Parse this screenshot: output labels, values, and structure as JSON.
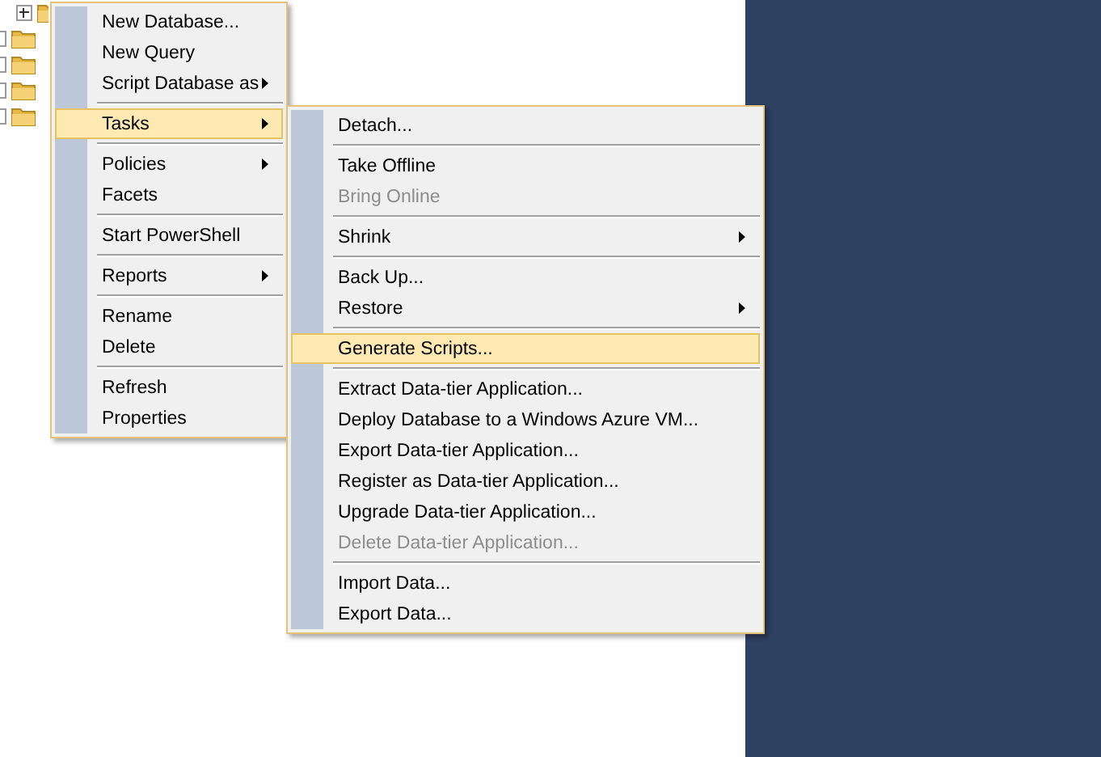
{
  "tree": {
    "items": [
      {
        "kind": "folder",
        "expanded": false
      },
      {
        "kind": "folder"
      },
      {
        "kind": "folder"
      },
      {
        "kind": "folder"
      },
      {
        "kind": "folder"
      }
    ]
  },
  "context_menu": {
    "items": [
      {
        "kind": "item",
        "label": "New Database...",
        "submenu": false,
        "selected": false,
        "disabled": false
      },
      {
        "kind": "item",
        "label": "New Query",
        "submenu": false,
        "selected": false,
        "disabled": false
      },
      {
        "kind": "item",
        "label": "Script Database as",
        "submenu": true,
        "selected": false,
        "disabled": false
      },
      {
        "kind": "separator"
      },
      {
        "kind": "item",
        "label": "Tasks",
        "submenu": true,
        "selected": true,
        "disabled": false
      },
      {
        "kind": "separator"
      },
      {
        "kind": "item",
        "label": "Policies",
        "submenu": true,
        "selected": false,
        "disabled": false
      },
      {
        "kind": "item",
        "label": "Facets",
        "submenu": false,
        "selected": false,
        "disabled": false
      },
      {
        "kind": "separator"
      },
      {
        "kind": "item",
        "label": "Start PowerShell",
        "submenu": false,
        "selected": false,
        "disabled": false
      },
      {
        "kind": "separator"
      },
      {
        "kind": "item",
        "label": "Reports",
        "submenu": true,
        "selected": false,
        "disabled": false
      },
      {
        "kind": "separator"
      },
      {
        "kind": "item",
        "label": "Rename",
        "submenu": false,
        "selected": false,
        "disabled": false
      },
      {
        "kind": "item",
        "label": "Delete",
        "submenu": false,
        "selected": false,
        "disabled": false
      },
      {
        "kind": "separator"
      },
      {
        "kind": "item",
        "label": "Refresh",
        "submenu": false,
        "selected": false,
        "disabled": false
      },
      {
        "kind": "item",
        "label": "Properties",
        "submenu": false,
        "selected": false,
        "disabled": false
      }
    ]
  },
  "tasks_submenu": {
    "items": [
      {
        "kind": "item",
        "label": "Detach...",
        "submenu": false,
        "selected": false,
        "disabled": false
      },
      {
        "kind": "separator"
      },
      {
        "kind": "item",
        "label": "Take Offline",
        "submenu": false,
        "selected": false,
        "disabled": false
      },
      {
        "kind": "item",
        "label": "Bring Online",
        "submenu": false,
        "selected": false,
        "disabled": true
      },
      {
        "kind": "separator"
      },
      {
        "kind": "item",
        "label": "Shrink",
        "submenu": true,
        "selected": false,
        "disabled": false
      },
      {
        "kind": "separator"
      },
      {
        "kind": "item",
        "label": "Back Up...",
        "submenu": false,
        "selected": false,
        "disabled": false
      },
      {
        "kind": "item",
        "label": "Restore",
        "submenu": true,
        "selected": false,
        "disabled": false
      },
      {
        "kind": "separator"
      },
      {
        "kind": "item",
        "label": "Generate Scripts...",
        "submenu": false,
        "selected": true,
        "disabled": false
      },
      {
        "kind": "separator"
      },
      {
        "kind": "item",
        "label": "Extract Data-tier Application...",
        "submenu": false,
        "selected": false,
        "disabled": false
      },
      {
        "kind": "item",
        "label": "Deploy Database to a Windows Azure VM...",
        "submenu": false,
        "selected": false,
        "disabled": false
      },
      {
        "kind": "item",
        "label": "Export Data-tier Application...",
        "submenu": false,
        "selected": false,
        "disabled": false
      },
      {
        "kind": "item",
        "label": "Register as Data-tier Application...",
        "submenu": false,
        "selected": false,
        "disabled": false
      },
      {
        "kind": "item",
        "label": "Upgrade Data-tier Application...",
        "submenu": false,
        "selected": false,
        "disabled": false
      },
      {
        "kind": "item",
        "label": "Delete Data-tier Application...",
        "submenu": false,
        "selected": false,
        "disabled": true
      },
      {
        "kind": "separator"
      },
      {
        "kind": "item",
        "label": "Import Data...",
        "submenu": false,
        "selected": false,
        "disabled": false
      },
      {
        "kind": "item",
        "label": "Export Data...",
        "submenu": false,
        "selected": false,
        "disabled": false
      }
    ]
  }
}
